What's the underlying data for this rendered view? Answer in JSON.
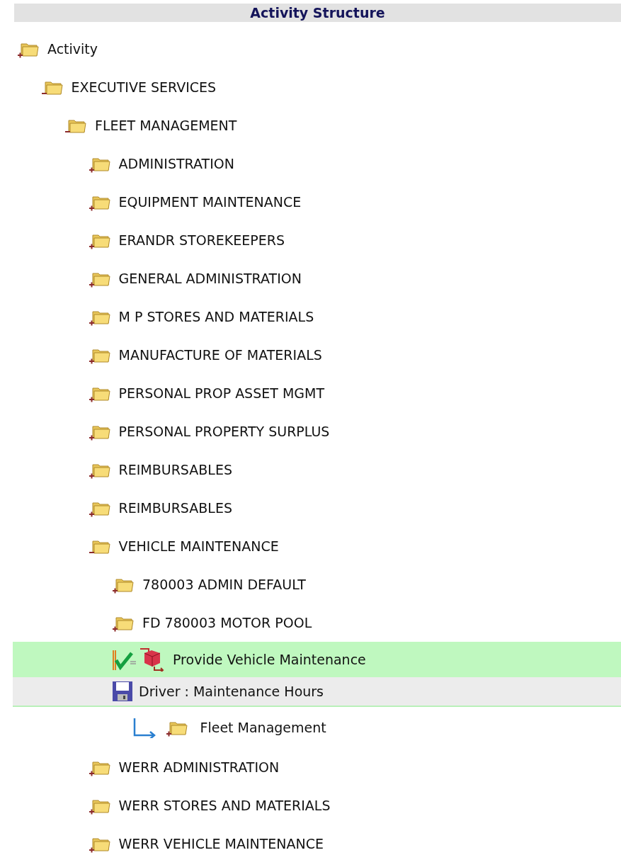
{
  "header": {
    "title": "Activity Structure"
  },
  "tree": [
    {
      "kind": "folder",
      "label": "Activity",
      "expanded": false,
      "children": [
        {
          "kind": "folder",
          "label": "EXECUTIVE SERVICES",
          "expanded": true,
          "children": [
            {
              "kind": "folder",
              "label": "FLEET MANAGEMENT",
              "expanded": true,
              "children": [
                {
                  "kind": "folder",
                  "label": "ADMINISTRATION",
                  "expanded": false
                },
                {
                  "kind": "folder",
                  "label": "EQUIPMENT MAINTENANCE",
                  "expanded": false
                },
                {
                  "kind": "folder",
                  "label": "ERANDR STOREKEEPERS",
                  "expanded": false
                },
                {
                  "kind": "folder",
                  "label": "GENERAL ADMINISTRATION",
                  "expanded": false
                },
                {
                  "kind": "folder",
                  "label": "M P STORES AND MATERIALS",
                  "expanded": false
                },
                {
                  "kind": "folder",
                  "label": "MANUFACTURE OF MATERIALS",
                  "expanded": false
                },
                {
                  "kind": "folder",
                  "label": "PERSONAL PROP ASSET MGMT",
                  "expanded": false
                },
                {
                  "kind": "folder",
                  "label": "PERSONAL PROPERTY SURPLUS",
                  "expanded": false
                },
                {
                  "kind": "folder",
                  "label": "REIMBURSABLES",
                  "expanded": false
                },
                {
                  "kind": "folder",
                  "label": "REIMBURSABLES",
                  "expanded": false
                },
                {
                  "kind": "folder",
                  "label": "VEHICLE MAINTENANCE",
                  "expanded": true,
                  "children": [
                    {
                      "kind": "folder",
                      "label": "780003 ADMIN DEFAULT",
                      "expanded": false
                    },
                    {
                      "kind": "folder",
                      "label": "FD 780003 MOTOR POOL",
                      "expanded": false
                    },
                    {
                      "kind": "activity",
                      "label": "Provide Vehicle Maintenance",
                      "selected": true
                    },
                    {
                      "kind": "driver",
                      "label": "Driver : Maintenance Hours",
                      "children": [
                        {
                          "kind": "link",
                          "label": "Fleet Management",
                          "expanded": false
                        }
                      ]
                    }
                  ]
                },
                {
                  "kind": "folder",
                  "label": "WERR ADMINISTRATION",
                  "expanded": false
                },
                {
                  "kind": "folder",
                  "label": "WERR STORES AND MATERIALS",
                  "expanded": false
                },
                {
                  "kind": "folder",
                  "label": "WERR VEHICLE MAINTENANCE",
                  "expanded": false
                }
              ]
            }
          ]
        }
      ]
    }
  ]
}
